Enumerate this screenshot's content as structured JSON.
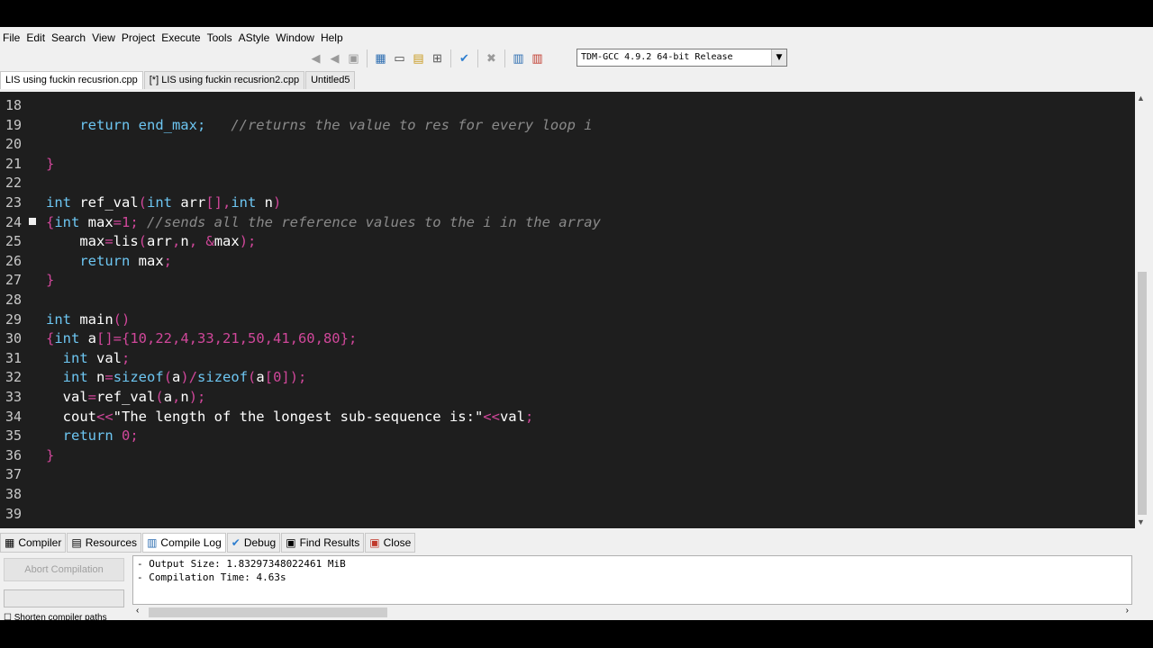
{
  "menu": [
    "File",
    "Edit",
    "Search",
    "View",
    "Project",
    "Execute",
    "Tools",
    "AStyle",
    "Window",
    "Help"
  ],
  "toolbar": {
    "compiler_select": "TDM-GCC 4.9.2 64-bit Release"
  },
  "tabs": [
    "LIS using fuckin recusrion.cpp",
    "[*] LIS using fuckin recusrion2.cpp",
    "Untitled5"
  ],
  "editor": {
    "lines": [
      {
        "n": "18",
        "segs": []
      },
      {
        "n": "19",
        "segs": [
          {
            "t": "    return end_max;   ",
            "c": "#6dc6f2"
          },
          {
            "t": "//returns the value to res for every loop i",
            "c": "#8a8a8a",
            "i": true
          }
        ]
      },
      {
        "n": "20",
        "segs": []
      },
      {
        "n": "21",
        "segs": [
          {
            "t": "}",
            "c": "#d0479a"
          }
        ]
      },
      {
        "n": "22",
        "segs": []
      },
      {
        "n": "23",
        "segs": [
          {
            "t": "int ",
            "c": "#6dc6f2"
          },
          {
            "t": "ref_val",
            "c": "#ffffff"
          },
          {
            "t": "(",
            "c": "#d0479a"
          },
          {
            "t": "int ",
            "c": "#6dc6f2"
          },
          {
            "t": "arr",
            "c": "#ffffff"
          },
          {
            "t": "[],",
            "c": "#d0479a"
          },
          {
            "t": "int ",
            "c": "#6dc6f2"
          },
          {
            "t": "n",
            "c": "#ffffff"
          },
          {
            "t": ")",
            "c": "#d0479a"
          }
        ]
      },
      {
        "n": "24",
        "fold": true,
        "segs": [
          {
            "t": "{",
            "c": "#d0479a"
          },
          {
            "t": "int ",
            "c": "#6dc6f2"
          },
          {
            "t": "max",
            "c": "#ffffff"
          },
          {
            "t": "=",
            "c": "#d0479a"
          },
          {
            "t": "1",
            "c": "#d0479a"
          },
          {
            "t": "; ",
            "c": "#d0479a"
          },
          {
            "t": "//sends all the reference values to the i in the array",
            "c": "#8a8a8a",
            "i": true
          }
        ]
      },
      {
        "n": "25",
        "segs": [
          {
            "t": "    max",
            "c": "#ffffff"
          },
          {
            "t": "=",
            "c": "#d0479a"
          },
          {
            "t": "lis",
            "c": "#ffffff"
          },
          {
            "t": "(",
            "c": "#d0479a"
          },
          {
            "t": "arr",
            "c": "#ffffff"
          },
          {
            "t": ",",
            "c": "#d0479a"
          },
          {
            "t": "n",
            "c": "#ffffff"
          },
          {
            "t": ", &",
            "c": "#d0479a"
          },
          {
            "t": "max",
            "c": "#ffffff"
          },
          {
            "t": ");",
            "c": "#d0479a"
          }
        ]
      },
      {
        "n": "26",
        "segs": [
          {
            "t": "    return ",
            "c": "#6dc6f2"
          },
          {
            "t": "max",
            "c": "#ffffff"
          },
          {
            "t": ";",
            "c": "#d0479a"
          }
        ]
      },
      {
        "n": "27",
        "segs": [
          {
            "t": "}",
            "c": "#d0479a"
          }
        ]
      },
      {
        "n": "28",
        "segs": []
      },
      {
        "n": "29",
        "segs": [
          {
            "t": "int ",
            "c": "#6dc6f2"
          },
          {
            "t": "main",
            "c": "#ffffff"
          },
          {
            "t": "()",
            "c": "#d0479a"
          }
        ]
      },
      {
        "n": "30",
        "segs": [
          {
            "t": "{",
            "c": "#d0479a"
          },
          {
            "t": "int ",
            "c": "#6dc6f2"
          },
          {
            "t": "a",
            "c": "#ffffff"
          },
          {
            "t": "[]={10,22,4,33,21,50,41,60,80};",
            "c": "#d0479a"
          }
        ]
      },
      {
        "n": "31",
        "segs": [
          {
            "t": "  int ",
            "c": "#6dc6f2"
          },
          {
            "t": "val",
            "c": "#ffffff"
          },
          {
            "t": ";",
            "c": "#d0479a"
          }
        ]
      },
      {
        "n": "32",
        "segs": [
          {
            "t": "  int ",
            "c": "#6dc6f2"
          },
          {
            "t": "n",
            "c": "#ffffff"
          },
          {
            "t": "=",
            "c": "#d0479a"
          },
          {
            "t": "sizeof",
            "c": "#6dc6f2"
          },
          {
            "t": "(",
            "c": "#d0479a"
          },
          {
            "t": "a",
            "c": "#ffffff"
          },
          {
            "t": ")/",
            "c": "#d0479a"
          },
          {
            "t": "sizeof",
            "c": "#6dc6f2"
          },
          {
            "t": "(",
            "c": "#d0479a"
          },
          {
            "t": "a",
            "c": "#ffffff"
          },
          {
            "t": "[0]);",
            "c": "#d0479a"
          }
        ]
      },
      {
        "n": "33",
        "segs": [
          {
            "t": "  val",
            "c": "#ffffff"
          },
          {
            "t": "=",
            "c": "#d0479a"
          },
          {
            "t": "ref_val",
            "c": "#ffffff"
          },
          {
            "t": "(",
            "c": "#d0479a"
          },
          {
            "t": "a",
            "c": "#ffffff"
          },
          {
            "t": ",",
            "c": "#d0479a"
          },
          {
            "t": "n",
            "c": "#ffffff"
          },
          {
            "t": ");",
            "c": "#d0479a"
          }
        ]
      },
      {
        "n": "34",
        "segs": [
          {
            "t": "  cout",
            "c": "#ffffff"
          },
          {
            "t": "<<",
            "c": "#d0479a"
          },
          {
            "t": "\"The length of the longest sub-sequence is:\"",
            "c": "#ffffff"
          },
          {
            "t": "<<",
            "c": "#d0479a"
          },
          {
            "t": "val",
            "c": "#ffffff"
          },
          {
            "t": ";",
            "c": "#d0479a"
          }
        ]
      },
      {
        "n": "35",
        "segs": [
          {
            "t": "  return ",
            "c": "#6dc6f2"
          },
          {
            "t": "0",
            "c": "#d0479a"
          },
          {
            "t": ";",
            "c": "#d0479a"
          }
        ]
      },
      {
        "n": "36",
        "segs": [
          {
            "t": "}",
            "c": "#d0479a"
          }
        ]
      },
      {
        "n": "37",
        "segs": []
      },
      {
        "n": "38",
        "segs": []
      },
      {
        "n": "39",
        "segs": []
      }
    ]
  },
  "bottom_tabs": [
    "Compiler",
    "Resources",
    "Compile Log",
    "Debug",
    "Find Results",
    "Close"
  ],
  "compile_panel": {
    "abort_label": "Abort Compilation",
    "shorten_label": "Shorten compiler paths",
    "log": [
      "- Output Size: 1.83297348022461 MiB",
      "- Compilation Time: 4.63s"
    ]
  },
  "colors": {
    "editor_bg": "#1e1e1e",
    "keyword": "#6dc6f2",
    "operator": "#d0479a",
    "comment": "#8a8a8a",
    "identifier": "#ffffff"
  }
}
